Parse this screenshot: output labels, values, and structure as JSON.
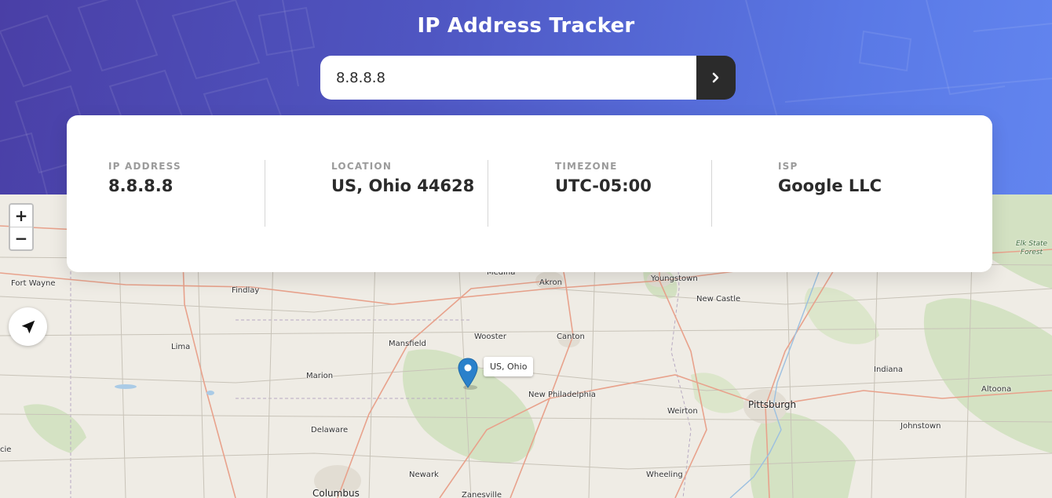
{
  "header": {
    "title": "IP Address Tracker"
  },
  "search": {
    "value": "8.8.8.8",
    "submit_icon": "chevron-right-icon"
  },
  "info": {
    "ip_label": "IP ADDRESS",
    "ip_value": "8.8.8.8",
    "location_label": "LOCATION",
    "location_value": "US, Ohio 44628",
    "timezone_label": "TIMEZONE",
    "timezone_value": "UTC-05:00",
    "isp_label": "ISP",
    "isp_value": "Google LLC"
  },
  "map": {
    "zoom_in": "+",
    "zoom_out": "−",
    "locate_icon": "navigation-arrow-icon",
    "marker_icon": "map-pin-icon",
    "popup_text": "US, Ohio",
    "places": {
      "fort_wayne": "Fort Wayne",
      "findlay": "Findlay",
      "lima": "Lima",
      "marion": "Marion",
      "delaware": "Delaware",
      "columbus": "Columbus",
      "newark": "Newark",
      "mansfield": "Mansfield",
      "wooster": "Wooster",
      "medina": "Medina",
      "akron": "Akron",
      "canton": "Canton",
      "youngstown": "Youngstown",
      "new_castle": "New Castle",
      "new_philadelphia": "New Philadelphia",
      "weirton": "Weirton",
      "wheeling": "Wheeling",
      "pittsburgh": "Pittsburgh",
      "indiana": "Indiana",
      "altoona": "Altoona",
      "johnstown": "Johnstown",
      "elk_state_forest": "Elk State Forest",
      "zanesville": "Zanesville",
      "edge_cie": "cie"
    }
  },
  "colors": {
    "header_start": "#4a3fa6",
    "header_end": "#6285ef",
    "button_dark": "#2b2b2b",
    "marker_blue": "#2a81cb"
  }
}
